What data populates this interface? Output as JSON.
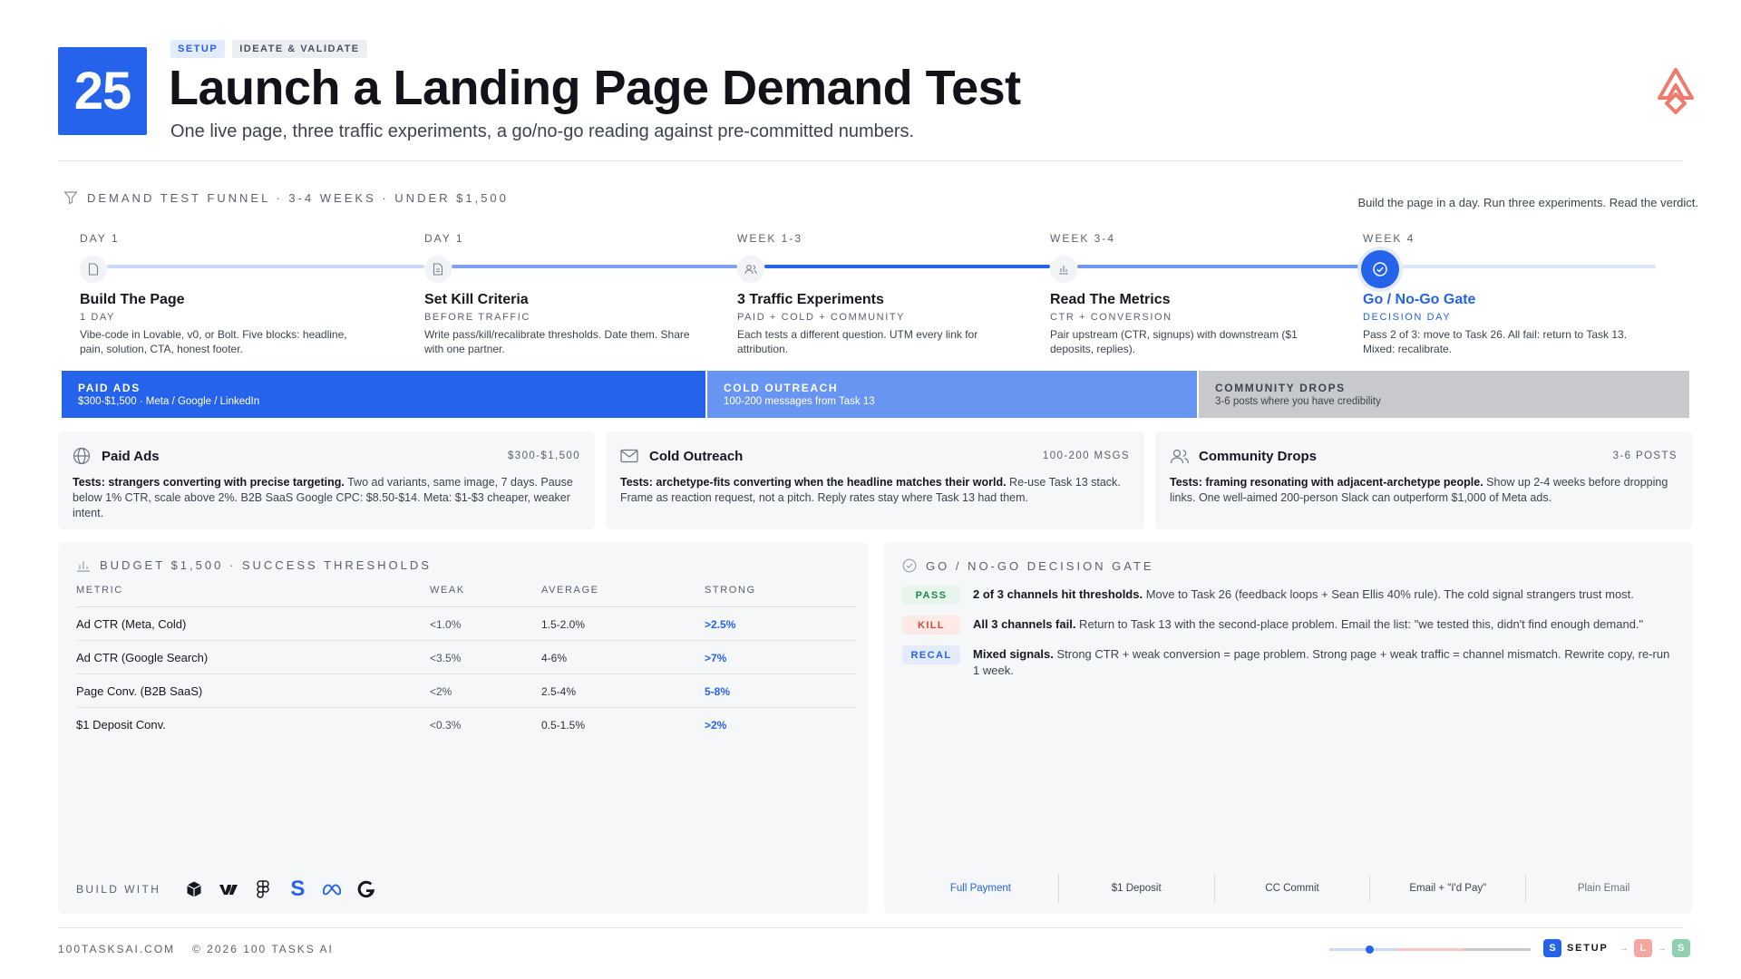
{
  "header": {
    "number": "25",
    "tags": [
      "SETUP",
      "IDEATE & VALIDATE"
    ],
    "title": "Launch a Landing Page Demand Test",
    "subtitle": "One live page, three traffic experiments, a go/no-go reading against pre-committed numbers."
  },
  "funnel": {
    "label": "DEMAND TEST FUNNEL · 3-4 WEEKS · UNDER $1,500",
    "note": "Build the page in a day. Run three experiments. Read the verdict.",
    "steps": [
      {
        "when": "DAY 1",
        "title": "Build The Page",
        "sub": "1 DAY",
        "desc": "Vibe-code in Lovable, v0, or Bolt. Five blocks: headline, pain, solution, CTA, honest footer.",
        "icon": "file-icon"
      },
      {
        "when": "DAY 1",
        "title": "Set Kill Criteria",
        "sub": "BEFORE TRAFFIC",
        "desc": "Write pass/kill/recalibrate thresholds. Date them. Share with one partner.",
        "icon": "document-icon"
      },
      {
        "when": "WEEK 1-3",
        "title": "3 Traffic Experiments",
        "sub": "PAID + COLD + COMMUNITY",
        "desc": "Each tests a different question. UTM every link for attribution.",
        "icon": "users-icon"
      },
      {
        "when": "WEEK 3-4",
        "title": "Read The Metrics",
        "sub": "CTR + CONVERSION",
        "desc": "Pair upstream (CTR, signups) with downstream ($1 deposits, replies).",
        "icon": "bar-chart-icon"
      },
      {
        "when": "WEEK 4",
        "title": "Go / No-Go Gate",
        "sub": "DECISION DAY",
        "desc": "Pass 2 of 3: move to Task 26. All fail: return to Task 13. Mixed: recalibrate.",
        "icon": "check-circle-icon"
      }
    ]
  },
  "channels_bar": [
    {
      "name": "PAID ADS",
      "desc": "$300-$1,500 · Meta / Google / LinkedIn",
      "color": "#2563eb"
    },
    {
      "name": "COLD OUTREACH",
      "desc": "100-200 messages from Task 13",
      "color": "#6895f2"
    },
    {
      "name": "COMMUNITY DROPS",
      "desc": "3-6 posts where you have credibility",
      "color": "#c8c9cc"
    }
  ],
  "channel_cards": [
    {
      "name": "Paid Ads",
      "amount": "$300-$1,500",
      "icon": "globe-icon",
      "lead": "Tests: strangers converting with precise targeting.",
      "body": " Two ad variants, same image, 7 days. Pause below 1% CTR, scale above 2%. B2B SaaS Google CPC: $8.50-$14. Meta: $1-$3 cheaper, weaker intent."
    },
    {
      "name": "Cold Outreach",
      "amount": "100-200 MSGS",
      "icon": "mail-icon",
      "lead": "Tests: archetype-fits converting when the headline matches their world.",
      "body": " Re-use Task 13 stack. Frame as reaction request, not a pitch. Reply rates stay where Task 13 had them."
    },
    {
      "name": "Community Drops",
      "amount": "3-6 POSTS",
      "icon": "users-icon",
      "lead": "Tests: framing resonating with adjacent-archetype people.",
      "body": " Show up 2-4 weeks before dropping links. One well-aimed 200-person Slack can outperform $1,000 of Meta ads."
    }
  ],
  "budget": {
    "label": "BUDGET $1,500 · SUCCESS THRESHOLDS",
    "columns": [
      "METRIC",
      "WEAK",
      "AVERAGE",
      "STRONG"
    ],
    "rows": [
      {
        "metric": "Ad CTR (Meta, Cold)",
        "weak": "<1.0%",
        "average": "1.5-2.0%",
        "strong": ">2.5%"
      },
      {
        "metric": "Ad CTR (Google Search)",
        "weak": "<3.5%",
        "average": "4-6%",
        "strong": ">7%"
      },
      {
        "metric": "Page Conv. (B2B SaaS)",
        "weak": "<2%",
        "average": "2.5-4%",
        "strong": "5-8%"
      },
      {
        "metric": "$1 Deposit Conv.",
        "weak": "<0.3%",
        "average": "0.5-1.5%",
        "strong": ">2%"
      }
    ],
    "build_with_label": "BUILD WITH",
    "build_tools": [
      "cube-icon",
      "webflow-icon",
      "figma-icon",
      "stripe-icon",
      "meta-icon",
      "google-icon"
    ]
  },
  "gate": {
    "label": "GO / NO-GO DECISION GATE",
    "rows": [
      {
        "pill": "PASS",
        "lead": "2 of 3 channels hit thresholds.",
        "body": " Move to Task 26 (feedback loops + Sean Ellis 40% rule). The cold signal strangers trust most."
      },
      {
        "pill": "KILL",
        "lead": "All 3 channels fail.",
        "body": " Return to Task 13 with the second-place problem. Email the list: \"we tested this, didn't find enough demand.\""
      },
      {
        "pill": "RECAL",
        "lead": "Mixed signals.",
        "body": " Strong CTR + weak conversion = page problem. Strong page + weak traffic = channel mismatch. Rewrite copy, re-run 1 week."
      }
    ],
    "signal_scale": [
      "Full Payment",
      "$1 Deposit",
      "CC Commit",
      "Email + \"I'd Pay\"",
      "Plain Email"
    ]
  },
  "footer": {
    "site": "100TASKSAI.COM",
    "copyright": "© 2026 100 TASKS AI",
    "progress_fraction": 0.2,
    "stages": [
      {
        "letter": "S",
        "label": "SETUP",
        "color": "#2563eb"
      },
      {
        "letter": "L",
        "color": "#f4a6a0"
      },
      {
        "letter": "S",
        "color": "#8fd0ae"
      }
    ]
  }
}
